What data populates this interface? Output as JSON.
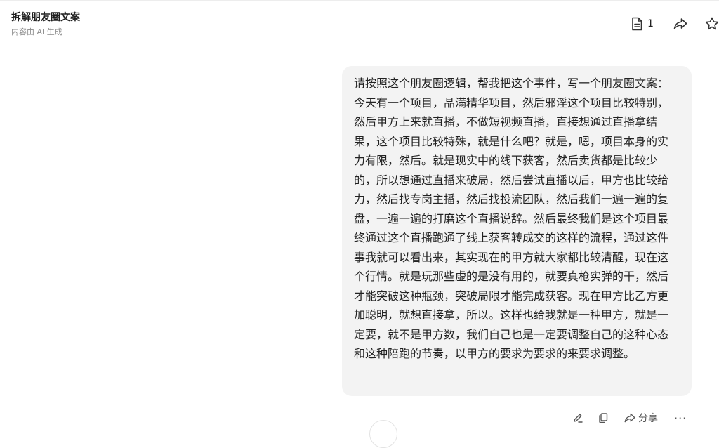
{
  "header": {
    "title": "拆解朋友圈文案",
    "subtitle": "内容由 AI 生成",
    "doc_count": "1",
    "icons": [
      "document-icon",
      "share-icon",
      "star-icon"
    ]
  },
  "message": {
    "text": "请按照这个朋友圈逻辑，帮我把这个事件，写一个朋友圈文案：今天有一个项目，晶满精华项目，然后邪淫这个项目比较特别，然后甲方上来就直播，不做短视频直播，直接想通过直播拿结果，这个项目比较特殊，就是什么吧？就是，嗯，项目本身的实力有限，然后。就是现实中的线下获客，然后卖货都是比较少的，所以想通过直播来破局，然后尝试直播以后，甲方也比较给力，然后找专岗主播，然后找投流团队，然后我们一遍一遍的复盘，一遍一遍的打磨这个直播说辞。然后最终我们是这个项目最终通过这个直播跑通了线上获客转成交的这样的流程，通过这件事我就可以看出来，其实现在的甲方就大家都比较清醒，现在这个行情。就是玩那些虚的是没有用的，就要真枪实弹的干，然后才能突破这种瓶颈，突破局限才能完成获客。现在甲方比乙方更加聪明，就想直接拿，所以。这样也给我就是一种甲方，就是一定要，就不是甲方数，我们自己也是一定要调整自己的这种心态和这种陪跑的节奏，以甲方的要求为要求的来要求调整。"
  },
  "actions": {
    "share_label": "分享",
    "more_label": "···",
    "icons": [
      "edit-icon",
      "copy-icon",
      "share-icon",
      "more-icon"
    ]
  }
}
